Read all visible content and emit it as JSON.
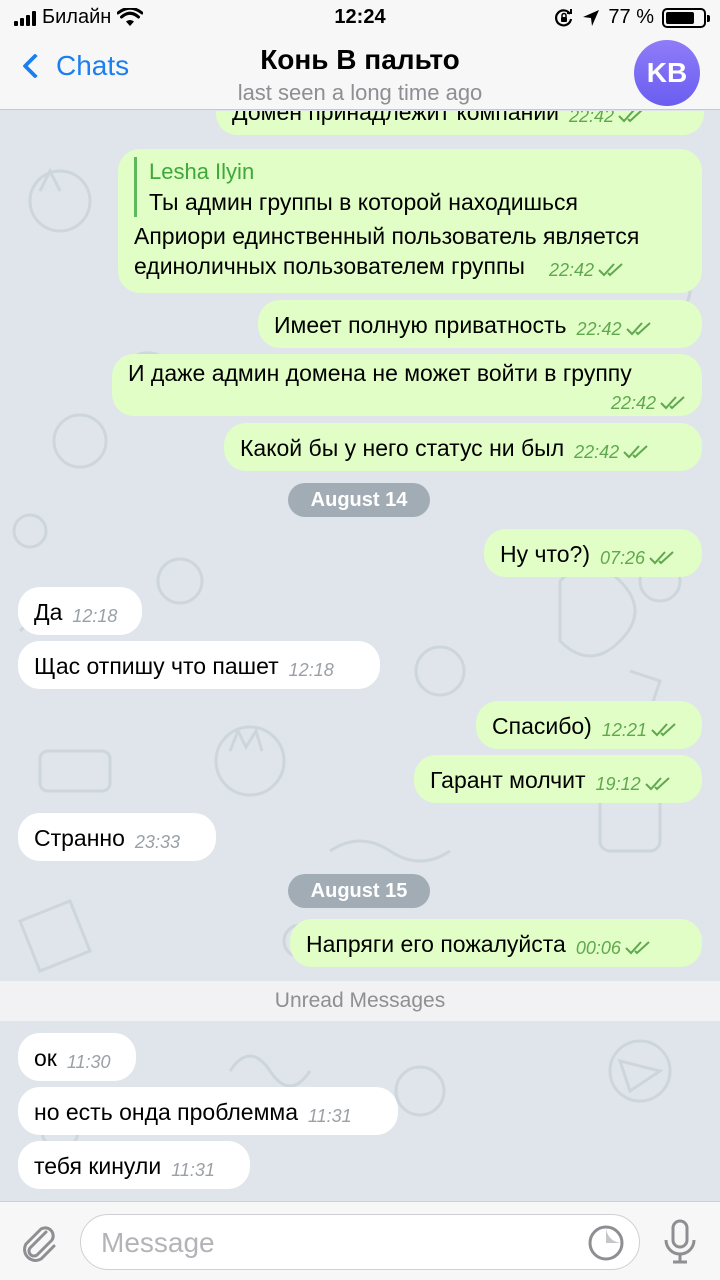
{
  "status_bar": {
    "carrier": "Билайн",
    "time": "12:24",
    "battery_percent": "77 %",
    "battery_level": 0.77
  },
  "nav": {
    "back_label": "Chats",
    "title": "Конь В пальто",
    "subtitle": "last seen a long time ago",
    "avatar_initials": "KB"
  },
  "messages": [
    {
      "dir": "out",
      "text": "Домен принадлежит компании",
      "time": "22:42"
    },
    {
      "dir": "out",
      "quote_author": "Lesha Ilyin",
      "quote_text": "Ты админ группы в которой находишься",
      "text_line1": "Априори единственный пользователь является",
      "text_line2": "единоличных пользователем группы",
      "time": "22:42"
    },
    {
      "dir": "out",
      "text": "Имеет полную приватность",
      "time": "22:42"
    },
    {
      "dir": "out",
      "text": "И даже админ домена не может войти в группу",
      "time": "22:42"
    },
    {
      "dir": "out",
      "text": "Какой бы у него статус ни был",
      "time": "22:42"
    },
    {
      "dir": "out",
      "text": "Ну что?)",
      "time": "07:26"
    },
    {
      "dir": "in",
      "text": "Да",
      "time": "12:18"
    },
    {
      "dir": "in",
      "text": "Щас отпишу что пашет",
      "time": "12:18"
    },
    {
      "dir": "out",
      "text": "Спасибо)",
      "time": "12:21"
    },
    {
      "dir": "out",
      "text": "Гарант молчит",
      "time": "19:12"
    },
    {
      "dir": "in",
      "text": "Странно",
      "time": "23:33"
    },
    {
      "dir": "out",
      "text": "Напряги его пожалуйста",
      "time": "00:06"
    },
    {
      "dir": "in",
      "text": "ок",
      "time": "11:30"
    },
    {
      "dir": "in",
      "text": "но есть онда проблемма",
      "time": "11:31"
    },
    {
      "dir": "in",
      "text": "тебя кинули",
      "time": "11:31"
    }
  ],
  "dates": [
    "August 14",
    "August 15"
  ],
  "unread_label": "Unread Messages",
  "input": {
    "placeholder": "Message",
    "value": ""
  },
  "colors": {
    "accent": "#1b7ff0",
    "outgoing_bubble": "#e1fec6",
    "incoming_bubble": "#ffffff",
    "background": "#dfe5ea",
    "time_green": "#5fa84f"
  },
  "icons": [
    "wifi-icon",
    "location-icon",
    "orientation-lock-icon",
    "battery-icon",
    "back-chevron-icon",
    "paperclip-icon",
    "sticker-icon",
    "microphone-icon",
    "double-check-icon"
  ]
}
